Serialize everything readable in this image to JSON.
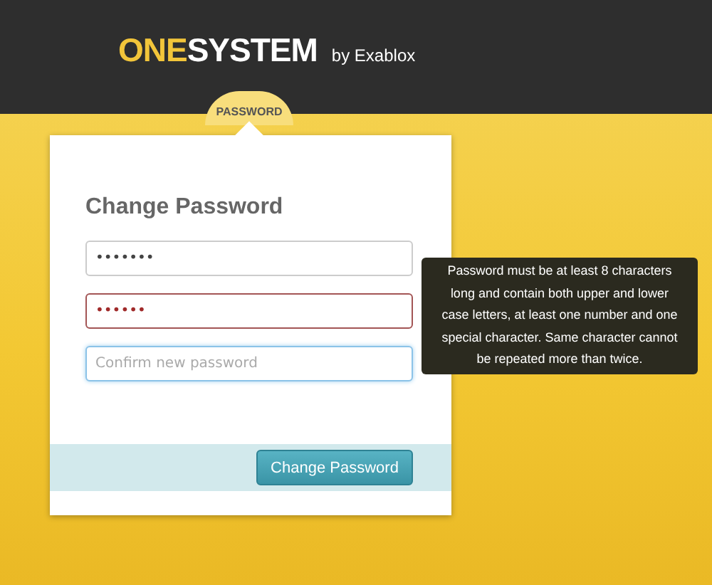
{
  "header": {
    "logo_accent": "ONE",
    "logo_main": "SYSTEM",
    "byline": "by Exablox"
  },
  "tab": {
    "label": "PASSWORD"
  },
  "card": {
    "title": "Change Password",
    "fields": [
      {
        "kind": "filled",
        "value": "•••••••"
      },
      {
        "kind": "error",
        "value": "••••••"
      },
      {
        "kind": "focused",
        "placeholder": "Confirm new password"
      }
    ],
    "tooltip": "Password must be at least 8 characters long and contain both upper and lower case letters, at least one number and one special character. Same character cannot be repeated more than twice.",
    "button": "Change Password"
  }
}
